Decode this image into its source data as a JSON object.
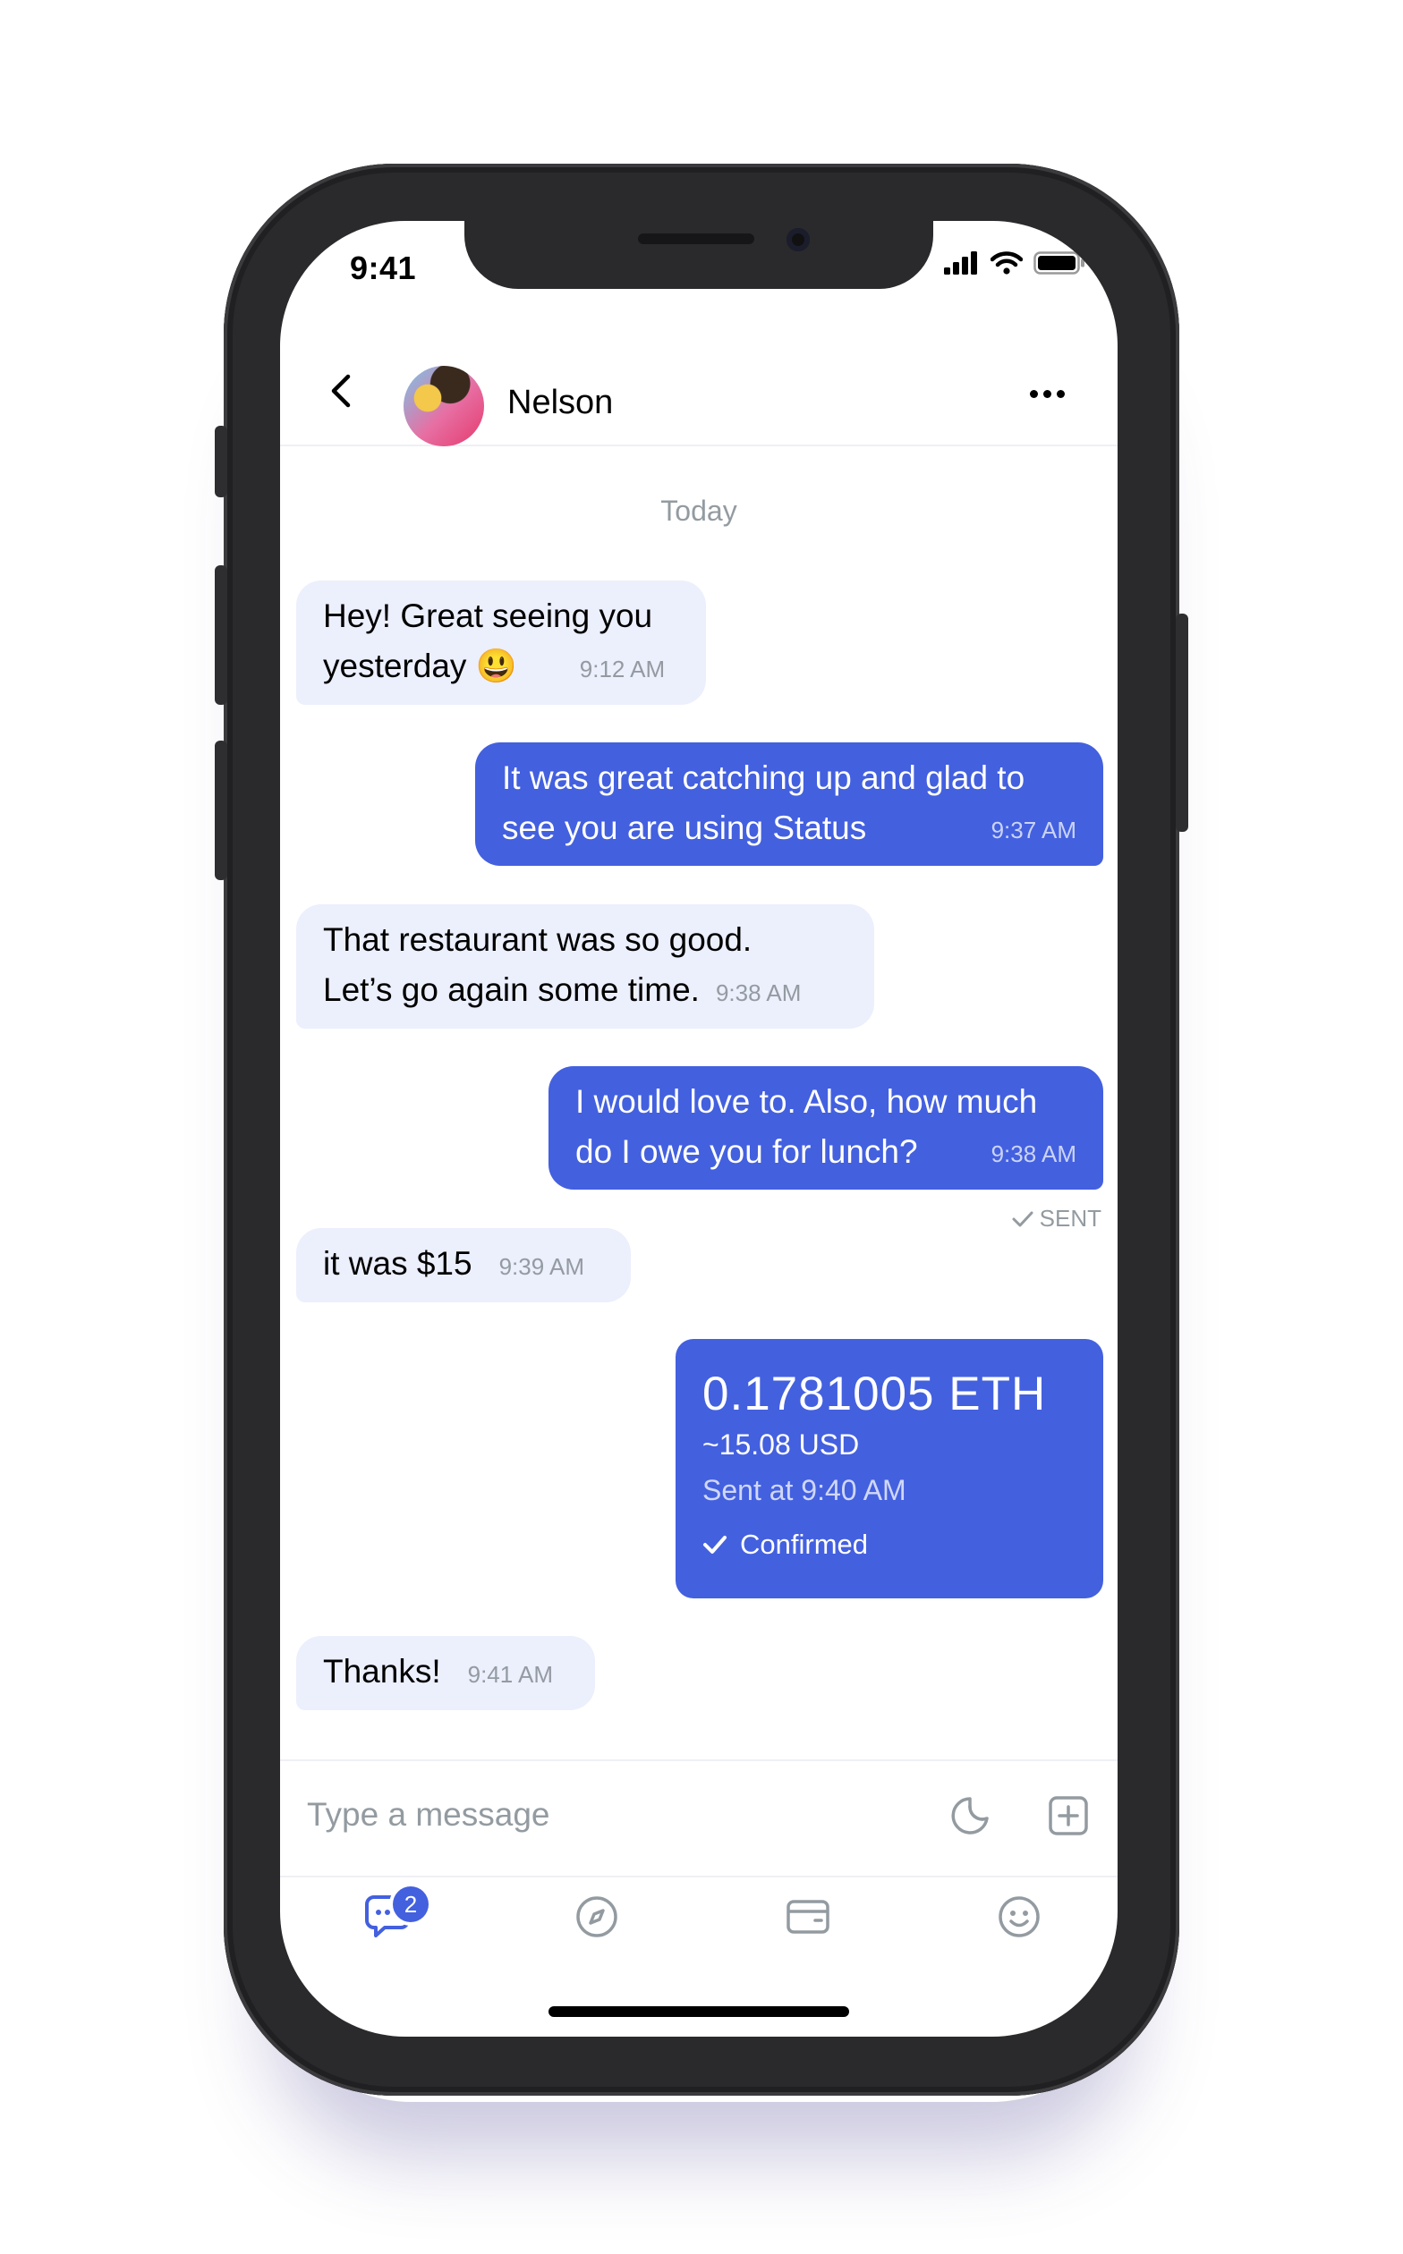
{
  "status_bar": {
    "time": "9:41"
  },
  "header": {
    "contact_name": "Nelson"
  },
  "date_divider": "Today",
  "messages": [
    {
      "direction": "in",
      "lines": [
        "Hey! Great seeing you",
        "yesterday 😃"
      ],
      "time": "9:12 AM"
    },
    {
      "direction": "out",
      "lines": [
        "It was great catching up and glad to",
        "see you are using Status"
      ],
      "time": "9:37 AM"
    },
    {
      "direction": "in",
      "lines": [
        "That restaurant was so good.",
        "Let’s go again some time."
      ],
      "time": "9:38 AM"
    },
    {
      "direction": "out",
      "lines": [
        "I would love to. Also, how much",
        "do I owe you for lunch?"
      ],
      "time": "9:38 AM"
    },
    {
      "direction": "in",
      "lines": [
        "it was $15"
      ],
      "time": "9:39 AM"
    },
    {
      "direction": "in",
      "lines": [
        "Thanks!"
      ],
      "time": "9:41 AM"
    }
  ],
  "sent_status": "SENT",
  "payment": {
    "amount": "0.1781005 ETH",
    "fiat": "~15.08 USD",
    "sent_at": "Sent at 9:40 AM",
    "status": "Confirmed"
  },
  "input": {
    "placeholder": "Type a message"
  },
  "tabs": {
    "chats_badge": "2",
    "icons": [
      "chat-icon",
      "compass-icon",
      "wallet-icon",
      "profile-icon"
    ]
  },
  "colors": {
    "accent": "#4360df",
    "incoming_bubble": "#eceffc",
    "muted_text": "#939ba1"
  }
}
